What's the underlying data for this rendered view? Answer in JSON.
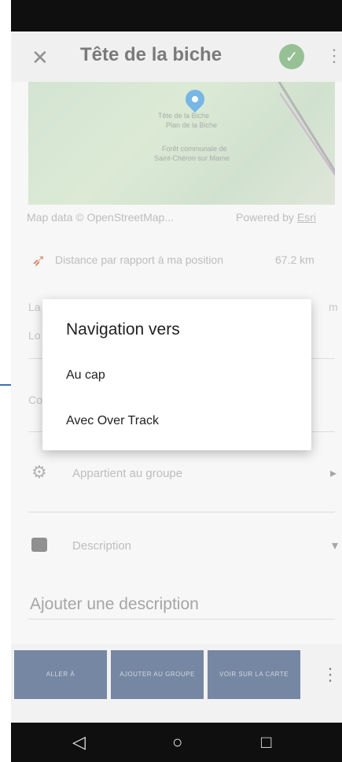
{
  "app": {
    "title": "Tête de la biche",
    "close_icon": "close-icon",
    "confirm_icon": "check-circle-icon",
    "more_icon": "more-vertical-icon"
  },
  "map": {
    "attribution_left": "Map data © OpenStreetMap...",
    "attribution_right_prefix": "Powered by ",
    "attribution_right_link": "Esri",
    "labels": [
      "Tête de la Biche",
      "Plan de la Biche",
      "Forêt communale de",
      "Saint-Chéron sur Marne"
    ]
  },
  "distance": {
    "label": "Distance par rapport à ma position",
    "value": "67.2 km"
  },
  "background_fields": {
    "row1_left": "La",
    "row1_right": "m",
    "row2_left": "Lo",
    "row3_left": "Co"
  },
  "group": {
    "label": "Appartient au groupe",
    "arrow": "▸"
  },
  "description": {
    "label": "Description",
    "arrow": "▾",
    "placeholder": "Ajouter une description"
  },
  "actions": {
    "go_to": "ALLER À",
    "add_to_group": "AJOUTER AU GROUPE",
    "see_on_map": "VOIR SUR LA CARTE",
    "more": "⋮"
  },
  "dialog": {
    "title": "Navigation vers",
    "options": [
      "Au cap",
      "Avec Over Track"
    ]
  },
  "navbar": {
    "back": "◁",
    "home": "○",
    "recents": "□"
  },
  "colors": {
    "accent": "#2b4870",
    "check": "#5ea05c",
    "pin": "#2f8fd8",
    "pointer_arrow": "#3b6fb5"
  }
}
